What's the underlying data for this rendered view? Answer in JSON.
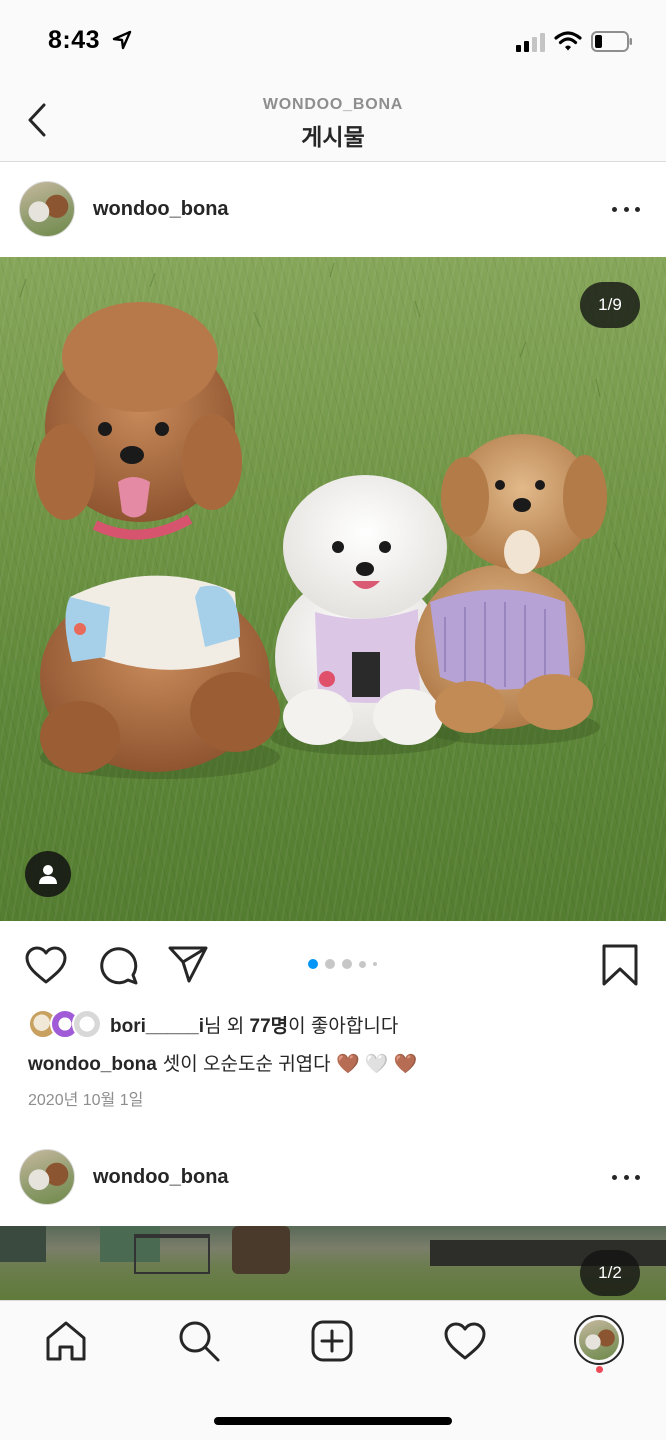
{
  "status_bar": {
    "time": "8:43"
  },
  "nav": {
    "subtitle": "WONDOO_BONA",
    "title": "게시물"
  },
  "post1": {
    "username": "wondoo_bona",
    "photo_counter": "1/9",
    "carousel": {
      "current": 1,
      "total": 9,
      "visible_dots": 5
    },
    "likes": {
      "user": "bori_____i",
      "mid": "님 외 ",
      "count": "77명",
      "tail": "이 좋아합니다"
    },
    "caption": {
      "username": "wondoo_bona",
      "text": "셋이 오순도순 귀엽다",
      "hearts": [
        "🤎",
        "🤍",
        "🤎"
      ]
    },
    "date": "2020년 10월 1일"
  },
  "post2": {
    "username": "wondoo_bona",
    "photo_counter": "1/2"
  },
  "colors": {
    "accent": "#0095f6",
    "text": "#262626",
    "muted": "#8e8e8e",
    "notification": "#ed4956",
    "heart_brown": "#7a4a26"
  },
  "icons": {
    "status": [
      "location-arrow-icon",
      "cellular-signal-icon",
      "wifi-icon",
      "battery-icon"
    ],
    "nav": [
      "back-chevron-icon"
    ],
    "post": [
      "more-options-icon",
      "user-tag-icon",
      "heart-icon",
      "comment-icon",
      "share-icon",
      "bookmark-icon"
    ],
    "tab_bar": [
      "home-icon",
      "search-icon",
      "add-post-icon",
      "activity-heart-icon",
      "profile-avatar"
    ]
  }
}
